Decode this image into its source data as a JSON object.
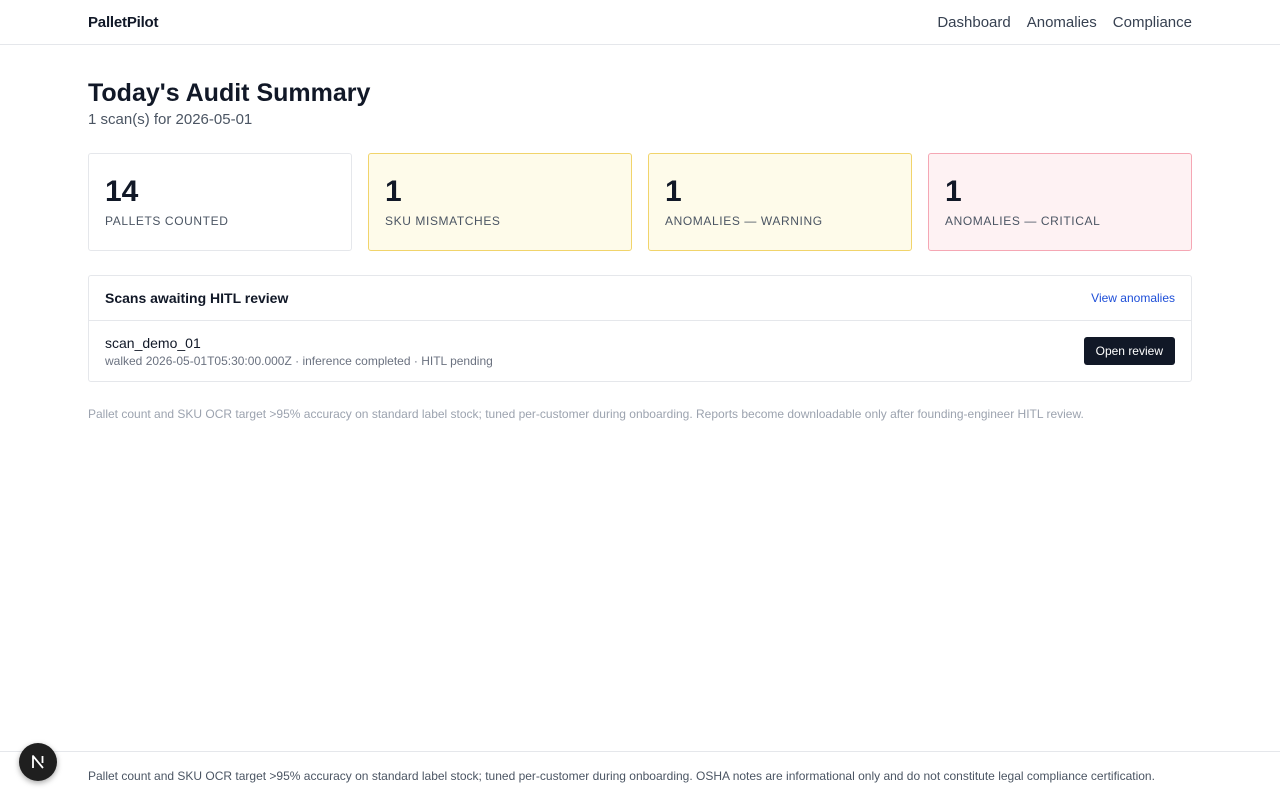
{
  "header": {
    "brand": "PalletPilot",
    "nav": [
      {
        "label": "Dashboard"
      },
      {
        "label": "Anomalies"
      },
      {
        "label": "Compliance"
      }
    ]
  },
  "page": {
    "title": "Today's Audit Summary",
    "subtitle": "1 scan(s) for 2026-05-01"
  },
  "stats": [
    {
      "value": "14",
      "label": "PALLETS COUNTED",
      "tone": "neutral"
    },
    {
      "value": "1",
      "label": "SKU MISMATCHES",
      "tone": "warning"
    },
    {
      "value": "1",
      "label": "ANOMALIES — WARNING",
      "tone": "warning"
    },
    {
      "value": "1",
      "label": "ANOMALIES — CRITICAL",
      "tone": "critical"
    }
  ],
  "review_panel": {
    "title": "Scans awaiting HITL review",
    "link_label": "View anomalies",
    "scans": [
      {
        "id": "scan_demo_01",
        "meta": "walked 2026-05-01T05:30:00.000Z · inference completed · HITL pending",
        "action_label": "Open review"
      }
    ]
  },
  "note": "Pallet count and SKU OCR target >95% accuracy on standard label stock; tuned per-customer during onboarding. Reports become downloadable only after founding-engineer HITL review.",
  "footer": {
    "text": "Pallet count and SKU OCR target >95% accuracy on standard label stock; tuned per-customer during onboarding. OSHA notes are informational only and do not constitute legal compliance certification."
  },
  "colors": {
    "primary_button": "#111827",
    "link": "#1d4ed8",
    "warning_bg": "#fefbea",
    "warning_border": "#f1d46b",
    "critical_bg": "#fef2f3",
    "critical_border": "#f5a7b4"
  },
  "icons": {
    "dev_badge": "next-logo-icon"
  }
}
